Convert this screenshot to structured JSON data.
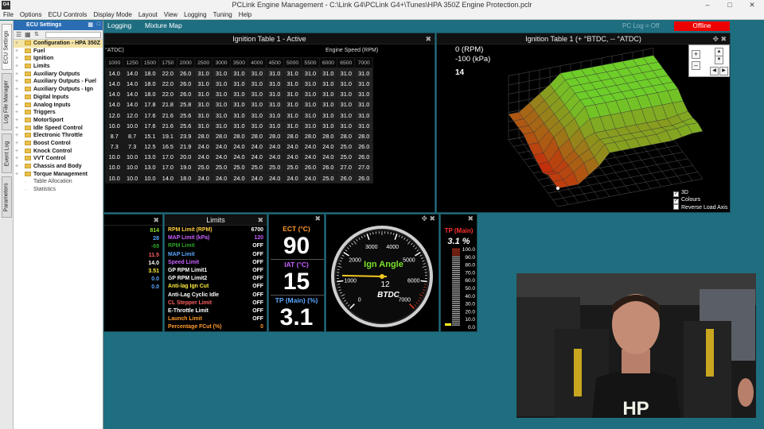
{
  "window": {
    "title": "PCLink Engine Management - C:\\Link G4\\PCLink G4+\\Tunes\\HPA 350Z Engine Protection.pclr",
    "logo": "G4"
  },
  "menu": [
    "File",
    "Options",
    "ECU Controls",
    "Display Mode",
    "Layout",
    "View",
    "Logging",
    "Tuning",
    "Help"
  ],
  "vertical_tabs": [
    "ECU Settings",
    "Log File Manager",
    "Event Log",
    "Parameters"
  ],
  "sidebar": {
    "title": "ECU Settings",
    "items": [
      {
        "label": "Configuration - HPA 350Z",
        "selected": true
      },
      {
        "label": "Fuel"
      },
      {
        "label": "Ignition"
      },
      {
        "label": "Limits"
      },
      {
        "label": "Auxiliary Outputs"
      },
      {
        "label": "Auxiliary Outputs - Fuel"
      },
      {
        "label": "Auxiliary Outputs - Ign"
      },
      {
        "label": "Digital Inputs"
      },
      {
        "label": "Analog Inputs"
      },
      {
        "label": "Triggers"
      },
      {
        "label": "MotorSport"
      },
      {
        "label": "Idle Speed Control"
      },
      {
        "label": "Electronic Throttle"
      },
      {
        "label": "Boost Control"
      },
      {
        "label": "Knock Control"
      },
      {
        "label": "VVT Control"
      },
      {
        "label": "Chassis and Body"
      },
      {
        "label": "Torque Management"
      },
      {
        "label": "Table Allocation",
        "plain": true
      },
      {
        "label": "Statistics",
        "plain": true
      }
    ]
  },
  "tabs": [
    "Logging",
    "Mixture Map"
  ],
  "status": {
    "pc_log": "PC Log = Off",
    "connection": "Offline"
  },
  "ign_table": {
    "title": "Ignition Table 1 - Active",
    "unit_label": "°ATDC)",
    "x_axis_label": "Engine Speed (RPM)",
    "rpm": [
      "1000",
      "1250",
      "1500",
      "1750",
      "2000",
      "2500",
      "3000",
      "3500",
      "4000",
      "4500",
      "5000",
      "5500",
      "6000",
      "6500",
      "7000"
    ],
    "rows": [
      [
        "14.0",
        "14.0",
        "18.0",
        "22.0",
        "26.0",
        "31.0",
        "31.0",
        "31.0",
        "31.0",
        "31.0",
        "31.0",
        "31.0",
        "31.0",
        "31.0",
        "31.0"
      ],
      [
        "14.0",
        "14.0",
        "18.0",
        "22.0",
        "26.0",
        "31.0",
        "31.0",
        "31.0",
        "31.0",
        "31.0",
        "31.0",
        "31.0",
        "31.0",
        "31.0",
        "31.0"
      ],
      [
        "14.0",
        "14.0",
        "18.0",
        "22.0",
        "26.0",
        "31.0",
        "31.0",
        "31.0",
        "31.0",
        "31.0",
        "31.0",
        "31.0",
        "31.0",
        "31.0",
        "31.0"
      ],
      [
        "14.0",
        "14.0",
        "17.8",
        "21.8",
        "25.8",
        "31.0",
        "31.0",
        "31.0",
        "31.0",
        "31.0",
        "31.0",
        "31.0",
        "31.0",
        "31.0",
        "31.0"
      ],
      [
        "12.0",
        "12.0",
        "17.6",
        "21.6",
        "25.6",
        "31.0",
        "31.0",
        "31.0",
        "31.0",
        "31.0",
        "31.0",
        "31.0",
        "31.0",
        "31.0",
        "31.0"
      ],
      [
        "10.0",
        "10.0",
        "17.6",
        "21.6",
        "25.6",
        "31.0",
        "31.0",
        "31.0",
        "31.0",
        "31.0",
        "31.0",
        "31.0",
        "31.0",
        "31.0",
        "31.0"
      ],
      [
        "8.7",
        "8.7",
        "15.1",
        "19.1",
        "23.9",
        "28.0",
        "28.0",
        "28.0",
        "28.0",
        "28.0",
        "28.0",
        "28.0",
        "28.0",
        "28.0",
        "28.0"
      ],
      [
        "7.3",
        "7.3",
        "12.5",
        "16.5",
        "21.9",
        "24.0",
        "24.0",
        "24.0",
        "24.0",
        "24.0",
        "24.0",
        "24.0",
        "24.0",
        "25.0",
        "26.0"
      ],
      [
        "10.0",
        "10.0",
        "13.0",
        "17.0",
        "20.0",
        "24.0",
        "24.0",
        "24.0",
        "24.0",
        "24.0",
        "24.0",
        "24.0",
        "24.0",
        "25.0",
        "26.0"
      ],
      [
        "10.0",
        "10.0",
        "13.0",
        "17.0",
        "19.0",
        "25.0",
        "25.0",
        "25.0",
        "25.0",
        "25.0",
        "25.0",
        "26.0",
        "26.0",
        "27.0",
        "27.0"
      ],
      [
        "10.0",
        "10.0",
        "10.0",
        "14.0",
        "18.0",
        "24.0",
        "24.0",
        "24.0",
        "24.0",
        "24.0",
        "24.0",
        "24.0",
        "25.0",
        "26.0",
        "26.0"
      ]
    ],
    "colors": {
      "low": "#c04000",
      "high": "#6fbf2a"
    }
  },
  "graph3d": {
    "title": "Ignition Table 1 (+ °BTDC, -- °ATDC)",
    "rpm_readout": "0 (RPM)",
    "map_readout": "-100 (kPa)",
    "value_readout": "14",
    "options": [
      {
        "label": "3D",
        "checked": true
      },
      {
        "label": "Colours",
        "checked": true
      },
      {
        "label": "Reverse Load Axis",
        "checked": false
      }
    ]
  },
  "status_values": {
    "values": [
      {
        "v": "814",
        "c": "#8be02a"
      },
      {
        "v": "28",
        "c": "#5aa8ff"
      },
      {
        "v": "-69",
        "c": "#2ea02a"
      },
      {
        "v": "11.5",
        "c": "#ff6060"
      },
      {
        "v": "14.0",
        "c": "#ffffff"
      },
      {
        "v": "3.51",
        "c": "#ffee40"
      },
      {
        "v": "0.0",
        "c": "#5aa8ff"
      },
      {
        "v": "0.0",
        "c": "#5aa8ff"
      }
    ]
  },
  "limits": {
    "title": "Limits",
    "rows": [
      {
        "name": "RPM Limit (RPM)",
        "value": "6700",
        "color": "#ffd040"
      },
      {
        "name": "MAP Limit (kPa)",
        "value": "120",
        "color": "#c860ff"
      },
      {
        "name": "RPM Limit",
        "value": "OFF",
        "color": "#2ea02a"
      },
      {
        "name": "MAP Limit",
        "value": "OFF",
        "color": "#5aa8ff"
      },
      {
        "name": "Speed Limit",
        "value": "OFF",
        "color": "#c860ff"
      },
      {
        "name": "GP RPM Limit1",
        "value": "OFF",
        "color": "#ffffff"
      },
      {
        "name": "GP RPM Limit2",
        "value": "OFF",
        "color": "#ffffff"
      },
      {
        "name": "Anti-lag Ign Cut",
        "value": "OFF",
        "color": "#ffee40"
      },
      {
        "name": "Anti-Lag Cyclic Idle",
        "value": "OFF",
        "color": "#ffffff"
      },
      {
        "name": "CL Stepper Limit",
        "value": "OFF",
        "color": "#ff6060"
      },
      {
        "name": "E-Throttle Limit",
        "value": "OFF",
        "color": "#ffffff"
      },
      {
        "name": "Launch Limit",
        "value": "OFF",
        "color": "#ff9a2a"
      },
      {
        "name": "Percentage FCut (%)",
        "value": "0",
        "color": "#ff9a2a"
      }
    ]
  },
  "numeric_gauges": {
    "ect_label": "ECT (°C)",
    "ect_value": "90",
    "iat_label": "IAT (°C)",
    "iat_value": "15",
    "tp_label": "TP (Main) (%)",
    "tp_value": "3.1"
  },
  "dial": {
    "title": "Ign Angle",
    "value": 12,
    "value_text": "12",
    "unit": "BTDC",
    "ticks": [
      "0",
      "1000",
      "2000",
      "3000",
      "4000",
      "5000",
      "6000",
      "7000"
    ]
  },
  "tp_bar": {
    "title": "TP (Main)",
    "value_text": "3.1 %",
    "value": 3.1,
    "ticks": [
      "100.0",
      "90.0",
      "80.0",
      "70.0",
      "60.0",
      "50.0",
      "40.0",
      "30.0",
      "20.0",
      "10.0",
      "0.0"
    ]
  },
  "video": {
    "shirt_text": "HP"
  }
}
